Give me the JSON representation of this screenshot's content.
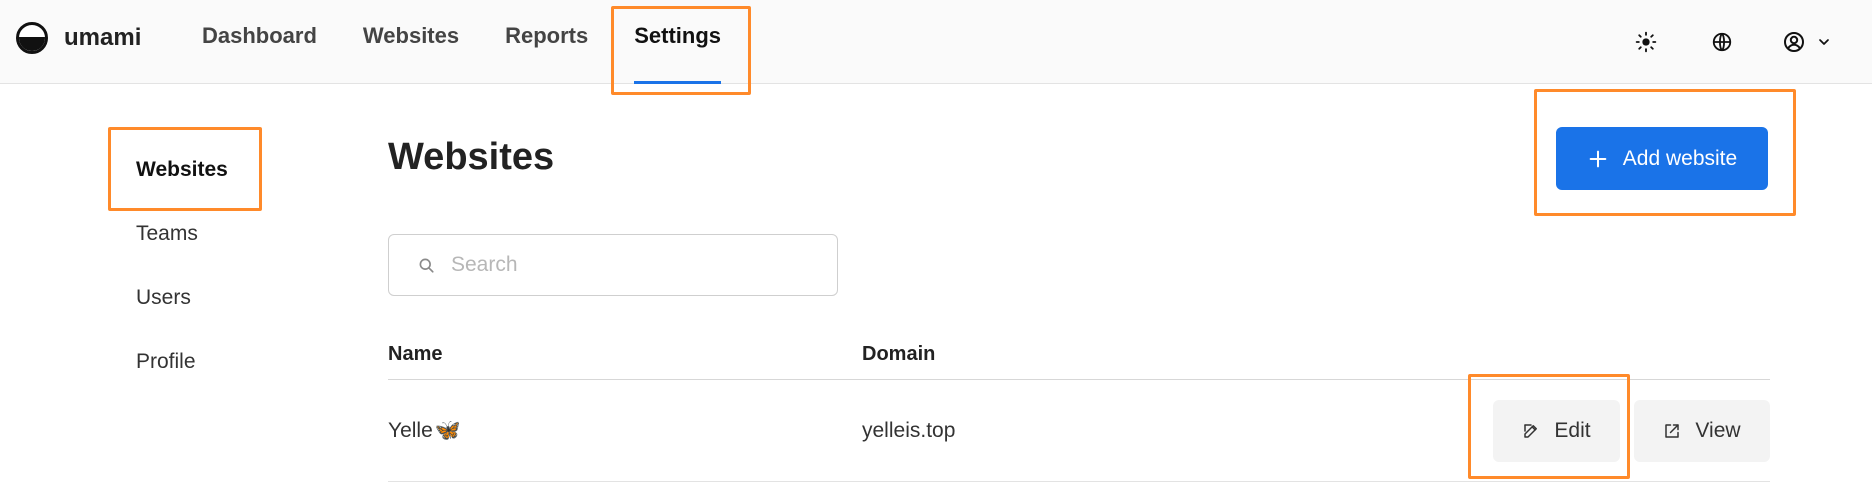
{
  "app": {
    "brand_name": "umami"
  },
  "topnav": {
    "items": [
      {
        "label": "Dashboard"
      },
      {
        "label": "Websites"
      },
      {
        "label": "Reports"
      },
      {
        "label": "Settings",
        "active": true
      }
    ]
  },
  "top_icons": {
    "theme": "sun-icon",
    "language": "globe-icon",
    "account": "user-icon",
    "account_menu": "chevron-down-icon"
  },
  "sidebar": {
    "items": [
      {
        "label": "Websites",
        "active": true
      },
      {
        "label": "Teams"
      },
      {
        "label": "Users"
      },
      {
        "label": "Profile"
      }
    ]
  },
  "main": {
    "title": "Websites",
    "add_button_label": "Add website",
    "search": {
      "placeholder": "Search",
      "value": ""
    },
    "table": {
      "columns": [
        "Name",
        "Domain"
      ],
      "rows": [
        {
          "name": "Yelle",
          "emoji": "🦋",
          "domain": "yelleis.top",
          "actions": [
            "Edit",
            "View"
          ]
        }
      ]
    }
  },
  "highlight_color": "#ff8a2a",
  "accent_color": "#1a73e8"
}
